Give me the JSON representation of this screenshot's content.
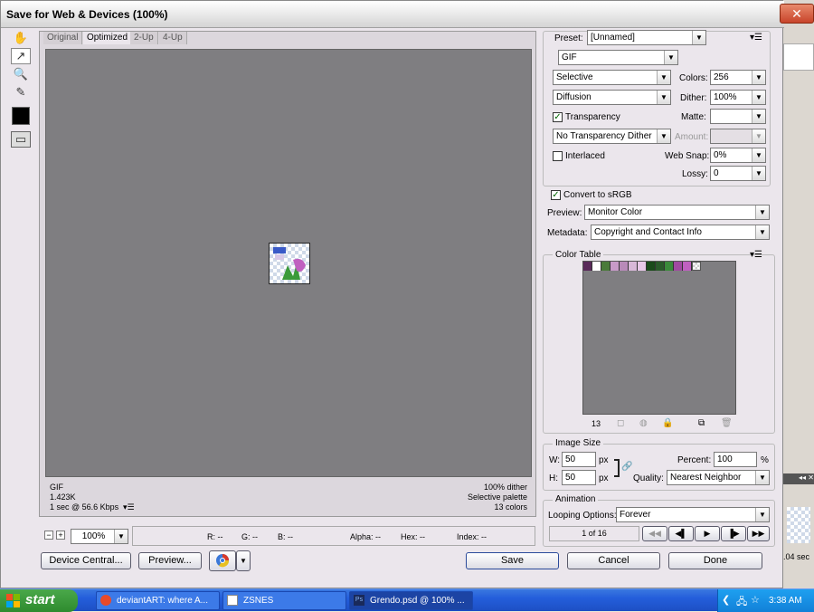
{
  "window": {
    "title": "Save for Web & Devices (100%)",
    "close_label": "x"
  },
  "tabs": [
    "Original",
    "Optimized",
    "2-Up",
    "4-Up"
  ],
  "image_info": {
    "format": "GIF",
    "size": "1.423K",
    "time": "1 sec @ 56.6 Kbps",
    "dither": "100% dither",
    "palette": "Selective palette",
    "colors": "13 colors"
  },
  "zoom": "100%",
  "status": {
    "r": "R: --",
    "g": "G: --",
    "b": "B: --",
    "alpha": "Alpha: --",
    "hex": "Hex: --",
    "index": "Index: --"
  },
  "bottom_buttons": {
    "device_central": "Device Central...",
    "preview": "Preview...",
    "save": "Save",
    "cancel": "Cancel",
    "done": "Done"
  },
  "settings": {
    "preset_label": "Preset:",
    "preset_value": "[Unnamed]",
    "format": "GIF",
    "reduction": "Selective",
    "colors_label": "Colors:",
    "colors_value": "256",
    "dither_algo": "Diffusion",
    "dither_label": "Dither:",
    "dither_value": "100%",
    "transparency_label": "Transparency",
    "matte_label": "Matte:",
    "trans_dither": "No Transparency Dither",
    "amount_label": "Amount:",
    "interlaced_label": "Interlaced",
    "websnap_label": "Web Snap:",
    "websnap_value": "0%",
    "lossy_label": "Lossy:",
    "lossy_value": "0",
    "srgb_label": "Convert to sRGB",
    "preview_label": "Preview:",
    "preview_value": "Monitor Color",
    "metadata_label": "Metadata:",
    "metadata_value": "Copyright and Contact Info"
  },
  "color_table": {
    "title": "Color Table",
    "count": "13",
    "swatches": [
      "#5a2a5a",
      "#ffffff",
      "#4a7a3a",
      "#c89ac8",
      "#b88ab8",
      "#d8b8d8",
      "#e8c8e8",
      "#1a4a1a",
      "#2a5a2a",
      "#3a8a3a",
      "#a04aa0",
      "#c060c0",
      "transparent"
    ]
  },
  "image_size": {
    "title": "Image Size",
    "w_label": "W:",
    "w_value": "50",
    "h_label": "H:",
    "h_value": "50",
    "unit": "px",
    "percent_label": "Percent:",
    "percent_value": "100",
    "percent_unit": "%",
    "quality_label": "Quality:",
    "quality_value": "Nearest Neighbor"
  },
  "animation": {
    "title": "Animation",
    "looping_label": "Looping Options:",
    "looping_value": "Forever",
    "frame": "1 of 16"
  },
  "taskbar": {
    "start": "start",
    "items": [
      "deviantART: where A...",
      "ZSNES",
      "Grendo.psd @ 100% ..."
    ],
    "clock": "3:38 AM"
  },
  "bg_app": {
    "time_text": ".04 sec"
  }
}
